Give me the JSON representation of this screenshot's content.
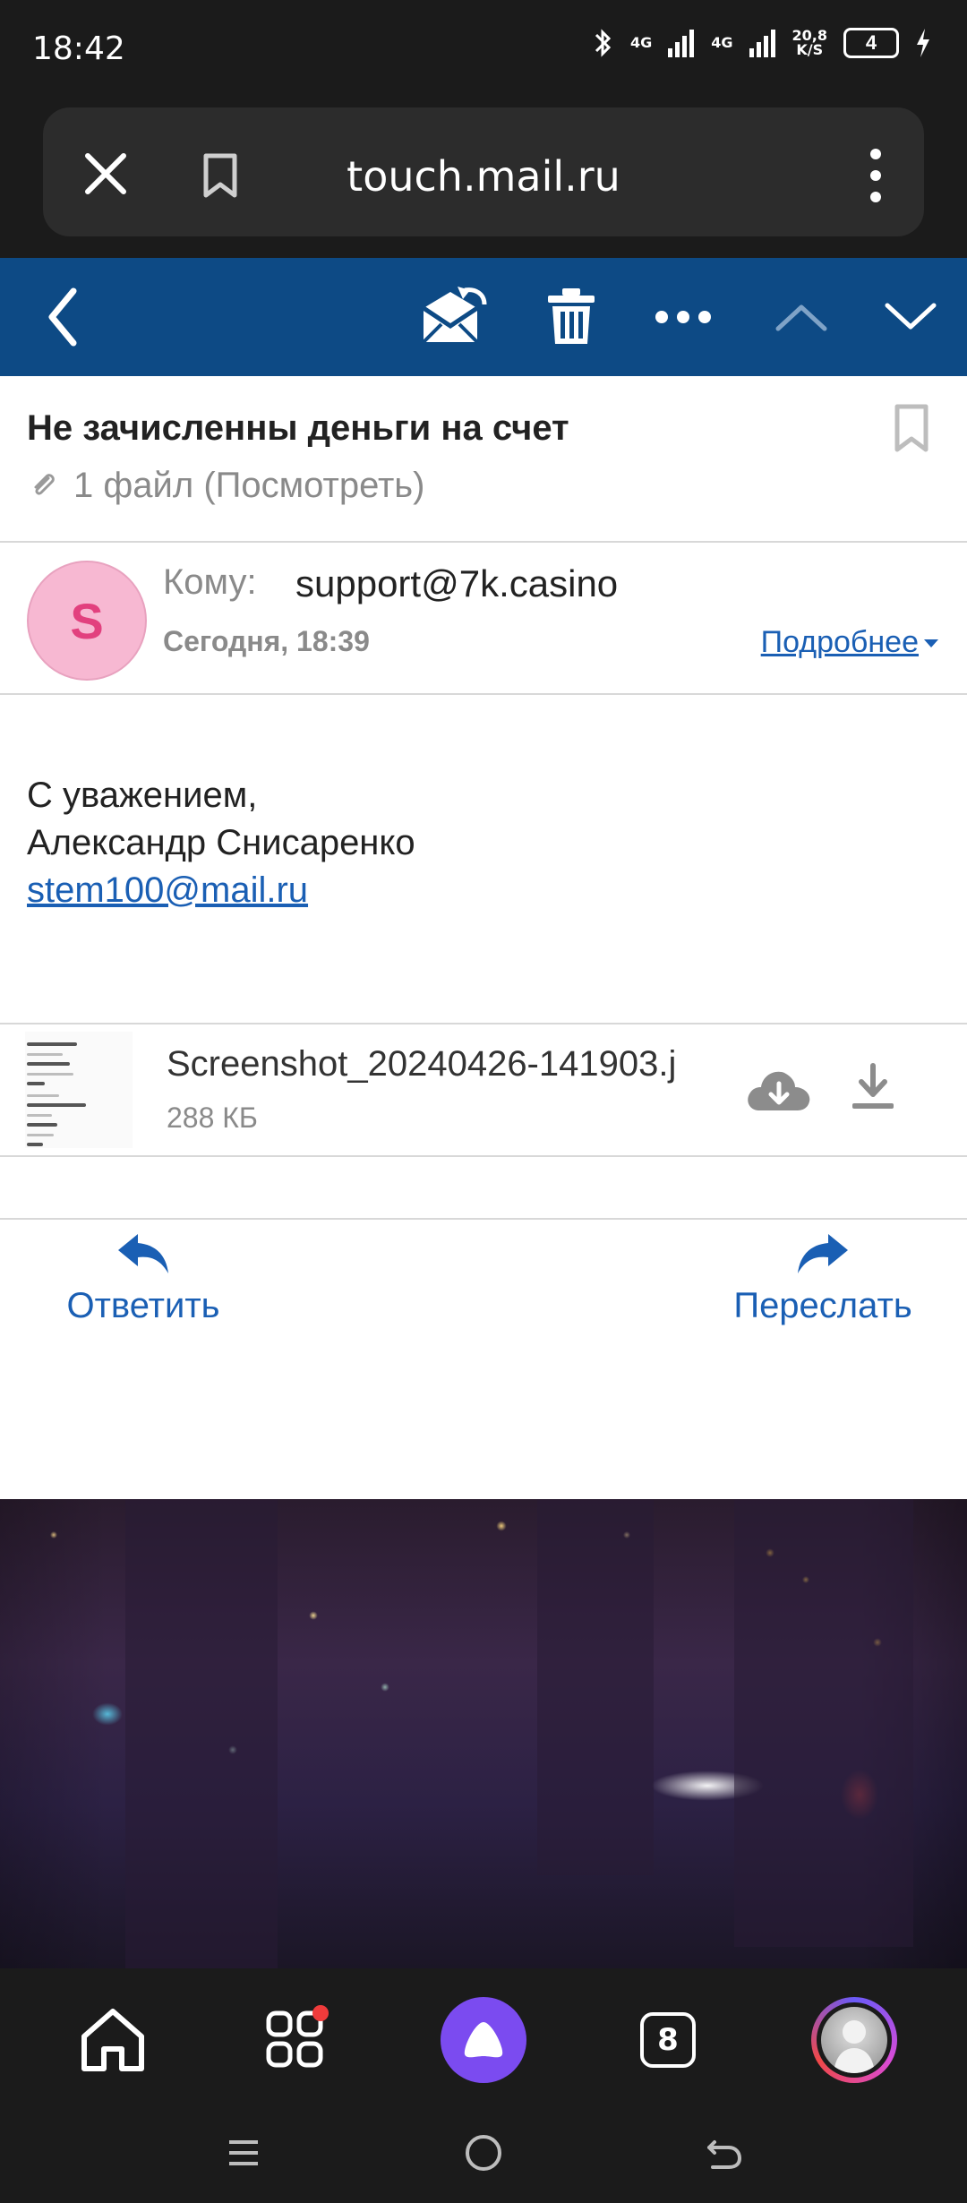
{
  "status_bar": {
    "time": "18:42",
    "network1": "4G",
    "network2": "4G",
    "speed_value": "20,8",
    "speed_unit": "K/S",
    "battery": "4"
  },
  "browser": {
    "url": "touch.mail.ru"
  },
  "mail_toolbar": {
    "icons": [
      "back-icon",
      "mark-unread-icon",
      "trash-icon",
      "more-icon",
      "previous-icon",
      "next-icon"
    ]
  },
  "message": {
    "subject": "Не зачисленны деньги на счет",
    "attachments_summary": "1 файл (Посмотреть)",
    "avatar_letter": "S",
    "to_label": "Кому:",
    "to_value": "support@7k.casino",
    "date": "Сегодня, 18:39",
    "more_link": "Подробнее",
    "body": {
      "line1": "С уважением,",
      "line2": "Александр Снисаренко",
      "email_link": "stem100@mail.ru"
    },
    "attachment": {
      "file_name": "Screenshot_20240426-141903.j",
      "file_size": "288 КБ"
    }
  },
  "actions": {
    "reply": "Ответить",
    "forward": "Переслать"
  },
  "bottom_nav": {
    "tabs_count": "8"
  },
  "colors": {
    "toolbar": "#0d4a85",
    "link": "#1a5fb4",
    "avatar_bg": "#f7b8d2",
    "avatar_text": "#e2407e",
    "alice": "#7b4bf0"
  }
}
